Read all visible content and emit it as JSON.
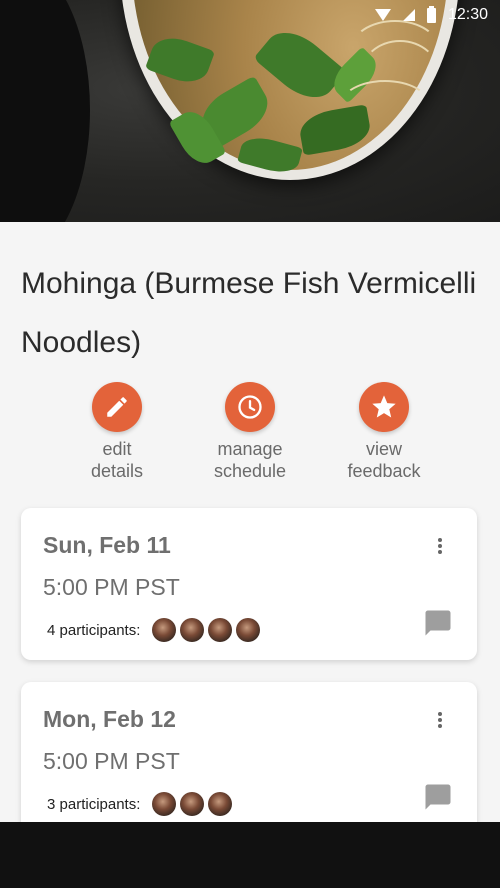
{
  "status_bar": {
    "time": "12:30"
  },
  "recipe": {
    "title": "Mohinga (Burmese Fish Vermicelli Noodles)"
  },
  "actions": [
    {
      "label": "edit\ndetails",
      "icon": "pencil-icon"
    },
    {
      "label": "manage\nschedule",
      "icon": "clock-icon"
    },
    {
      "label": "view\nfeedback",
      "icon": "star-icon"
    }
  ],
  "sessions": [
    {
      "day": "Sun, Feb 11",
      "time": "5:00 PM PST",
      "participants": "4 participants:",
      "participant_count": 4
    },
    {
      "day": "Mon, Feb 12",
      "time": "5:00 PM PST",
      "participants": "3 participants:",
      "participant_count": 3
    }
  ],
  "colors": {
    "accent": "#e3633a",
    "text_primary": "#2b2b2b",
    "text_secondary": "#6f6f6f"
  }
}
